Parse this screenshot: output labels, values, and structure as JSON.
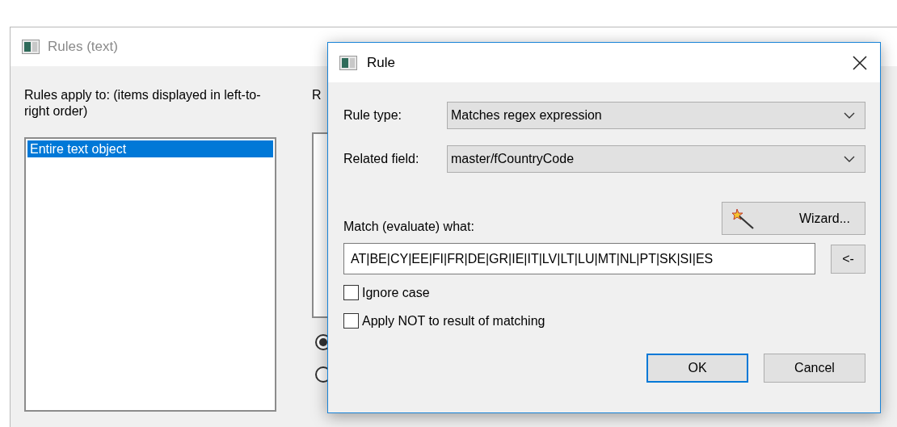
{
  "background_window": {
    "title": "Rules (text)",
    "apply_label": "Rules apply to: (items displayed in left-to-right order)",
    "items": [
      {
        "label": "Entire text object",
        "selected": true
      }
    ],
    "column_2_label": "R",
    "radios": [
      {
        "selected": true
      },
      {
        "selected": false
      }
    ]
  },
  "dialog": {
    "title": "Rule",
    "fields": [
      {
        "label": "Rule type:",
        "value": "Matches regex expression"
      },
      {
        "label": "Related field:",
        "value": "master/fCountryCode"
      }
    ],
    "wizard_button": "Wizard...",
    "match_label": "Match (evaluate) what:",
    "match_value": "AT|BE|CY|EE|FI|FR|DE|GR|IE|IT|LV|LT|LU|MT|NL|PT|SK|SI|ES",
    "insert_button": "<-",
    "checkboxes": [
      {
        "label": "Ignore case",
        "checked": false
      },
      {
        "label": "Apply NOT to result of matching",
        "checked": false
      }
    ],
    "buttons": [
      {
        "label": "OK",
        "default": true
      },
      {
        "label": "Cancel",
        "default": false
      }
    ]
  }
}
